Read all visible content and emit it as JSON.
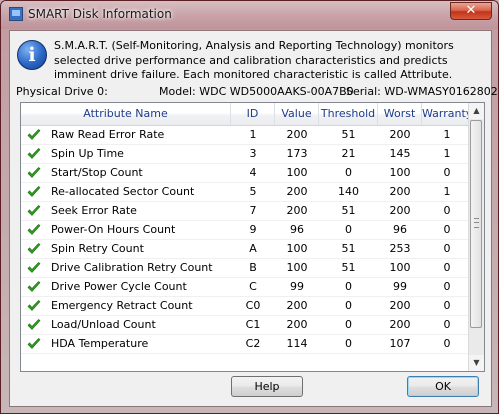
{
  "window": {
    "title": "SMART Disk Information",
    "close_glyph": "✕"
  },
  "info": {
    "icon": "information-icon",
    "description": "S.M.A.R.T. (Self-Monitoring, Analysis and Reporting Technology) monitors selected drive performance and calibration characteristics and predicts imminent drive failure. Each monitored characteristic is called Attribute."
  },
  "drive": {
    "physical_drive": "Physical Drive 0:",
    "model": "Model: WDC WD5000AAKS-00A7B0",
    "serial": "Serial: WD-WMASY0162802"
  },
  "table": {
    "columns": [
      "Attribute Name",
      "ID",
      "Value",
      "Threshold",
      "Worst",
      "Warranty"
    ],
    "rows": [
      {
        "name": "Raw Read Error Rate",
        "id": "1",
        "value": "200",
        "threshold": "51",
        "worst": "200",
        "warranty": "1"
      },
      {
        "name": "Spin Up Time",
        "id": "3",
        "value": "173",
        "threshold": "21",
        "worst": "145",
        "warranty": "1"
      },
      {
        "name": "Start/Stop Count",
        "id": "4",
        "value": "100",
        "threshold": "0",
        "worst": "100",
        "warranty": "0"
      },
      {
        "name": "Re-allocated Sector Count",
        "id": "5",
        "value": "200",
        "threshold": "140",
        "worst": "200",
        "warranty": "1"
      },
      {
        "name": "Seek Error Rate",
        "id": "7",
        "value": "200",
        "threshold": "51",
        "worst": "200",
        "warranty": "0"
      },
      {
        "name": "Power-On Hours Count",
        "id": "9",
        "value": "96",
        "threshold": "0",
        "worst": "96",
        "warranty": "0"
      },
      {
        "name": "Spin Retry Count",
        "id": "A",
        "value": "100",
        "threshold": "51",
        "worst": "253",
        "warranty": "0"
      },
      {
        "name": "Drive Calibration Retry Count",
        "id": "B",
        "value": "100",
        "threshold": "51",
        "worst": "100",
        "warranty": "0"
      },
      {
        "name": "Drive Power Cycle Count",
        "id": "C",
        "value": "99",
        "threshold": "0",
        "worst": "99",
        "warranty": "0"
      },
      {
        "name": "Emergency Retract Count",
        "id": "C0",
        "value": "200",
        "threshold": "0",
        "worst": "200",
        "warranty": "0"
      },
      {
        "name": "Load/Unload Count",
        "id": "C1",
        "value": "200",
        "threshold": "0",
        "worst": "200",
        "warranty": "0"
      },
      {
        "name": "HDA Temperature",
        "id": "C2",
        "value": "114",
        "threshold": "0",
        "worst": "107",
        "warranty": "0"
      }
    ]
  },
  "buttons": {
    "help": "Help",
    "ok": "OK"
  },
  "colors": {
    "check": "#2ea21c",
    "header_text": "#1c3c8c"
  }
}
